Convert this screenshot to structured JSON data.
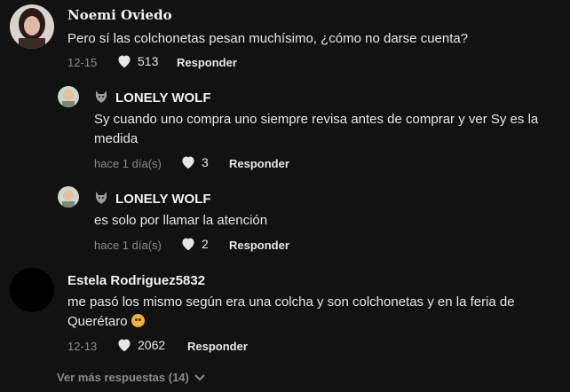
{
  "comments": [
    {
      "name": "𝐍oemi Oviedo",
      "text": "Pero sí las colchonetas pesan muchísimo, ¿cómo no darse cuenta?",
      "date": "12-15",
      "likes": "513",
      "reply": "Responder"
    },
    {
      "name": "LONELY WOLF",
      "text": "Sy cuando uno compra uno siempre revisa antes de comprar y ver Sy es la medida",
      "date": "hace 1 día(s)",
      "likes": "3",
      "reply": "Responder"
    },
    {
      "name": "LONELY WOLF",
      "text": "es solo por llamar la atención",
      "date": "hace 1 día(s)",
      "likes": "2",
      "reply": "Responder"
    },
    {
      "name": "Estela Rodriguez5832",
      "text": "me pasó los mismo según era una colcha y son colchonetas y en la feria de Querétaro",
      "date": "12-13",
      "likes": "2062",
      "reply": "Responder"
    }
  ],
  "more_replies": "Ver más respuestas (14)",
  "icons": {
    "like": "heart-icon",
    "wolf": "wolf-icon",
    "emoji": "pleading-face-emoji",
    "chevron": "chevron-down-icon"
  }
}
